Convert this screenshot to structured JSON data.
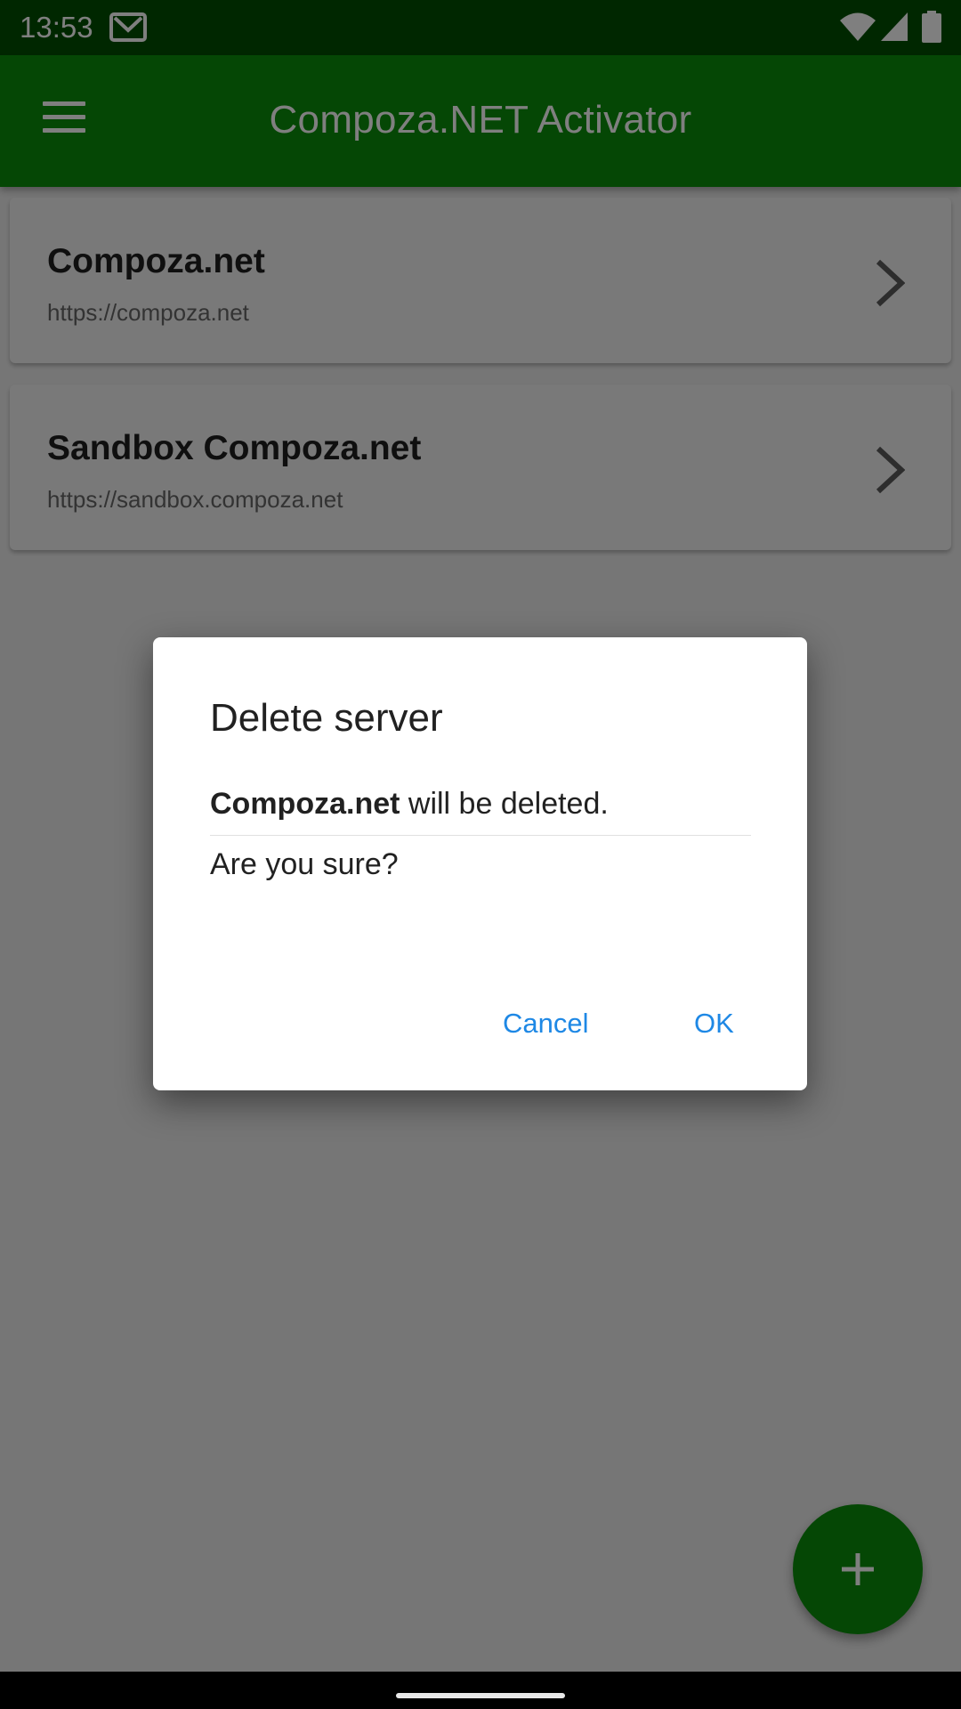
{
  "status_bar": {
    "time": "13:53",
    "icons": [
      "gmail-icon",
      "wifi-icon",
      "signal-icon",
      "battery-icon"
    ]
  },
  "app_bar": {
    "title": "Compoza.NET Activator",
    "menu_icon": "menu-icon"
  },
  "servers": [
    {
      "name": "Compoza.net",
      "url": "https://compoza.net"
    },
    {
      "name": "Sandbox Compoza.net",
      "url": "https://sandbox.compoza.net"
    }
  ],
  "dialog": {
    "title": "Delete server",
    "message_bold": "Compoza.net",
    "message_rest": " will be deleted.",
    "question": "Are you sure?",
    "cancel_label": "Cancel",
    "ok_label": "OK"
  },
  "fab": {
    "icon": "plus-icon"
  },
  "colors": {
    "primary": "#0a8f0a",
    "status_bar": "#004f00",
    "accent": "#1e88e5"
  }
}
